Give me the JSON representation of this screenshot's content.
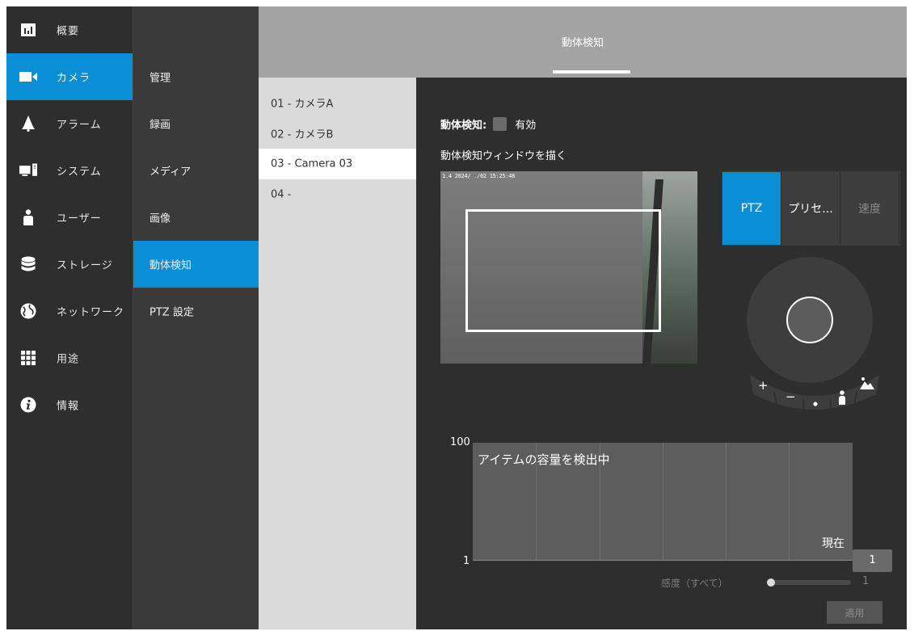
{
  "sidebar": {
    "items": [
      {
        "label": "概要",
        "icon": "bar-chart-icon"
      },
      {
        "label": "カメラ",
        "icon": "video-camera-icon"
      },
      {
        "label": "アラーム",
        "icon": "bell-icon"
      },
      {
        "label": "システム",
        "icon": "computer-icon"
      },
      {
        "label": "ユーザー",
        "icon": "user-icon"
      },
      {
        "label": "ストレージ",
        "icon": "database-icon"
      },
      {
        "label": "ネットワーク",
        "icon": "globe-icon"
      },
      {
        "label": "用途",
        "icon": "grid-icon"
      },
      {
        "label": "情報",
        "icon": "info-icon"
      }
    ],
    "active_index": 1
  },
  "submenu": {
    "items": [
      {
        "label": "管理"
      },
      {
        "label": "録画"
      },
      {
        "label": "メディア"
      },
      {
        "label": "画像"
      },
      {
        "label": "動体検知"
      },
      {
        "label": "PTZ 設定"
      }
    ],
    "active_index": 4
  },
  "header": {
    "title": "動体検知"
  },
  "cameras": {
    "items": [
      {
        "label": "01 - カメラA"
      },
      {
        "label": "02 - カメラB"
      },
      {
        "label": "03 - Camera 03"
      },
      {
        "label": "04 -"
      }
    ],
    "active_index": 2
  },
  "content": {
    "motion_detection_label": "動体検知:",
    "enabled_label": "有効",
    "draw_window_label": "動体検知ウィンドウを描く",
    "video_osd": "1.4 2024/ ./02 15:25:48",
    "ptz_tabs": [
      {
        "label": "PTZ",
        "state": "active"
      },
      {
        "label": "プリセ...",
        "state": "normal"
      },
      {
        "label": "速度",
        "state": "disabled"
      }
    ],
    "zoom_in": "+",
    "zoom_out": "−",
    "graph": {
      "title": "アイテムの容量を検出中",
      "y_max": "100",
      "y_min": "1",
      "current_label": "現在",
      "current_value": "1"
    },
    "sensitivity_label": "感度（すべて）",
    "sensitivity_value": "1",
    "apply_label": "適用"
  },
  "colors": {
    "accent": "#0a8fd6",
    "sidebar_bg": "#2e2e2e",
    "submenu_bg": "#3a3a3a",
    "header_bg": "#a3a3a3",
    "camera_list_bg": "#dadada",
    "content_bg": "#2e2e2e"
  }
}
